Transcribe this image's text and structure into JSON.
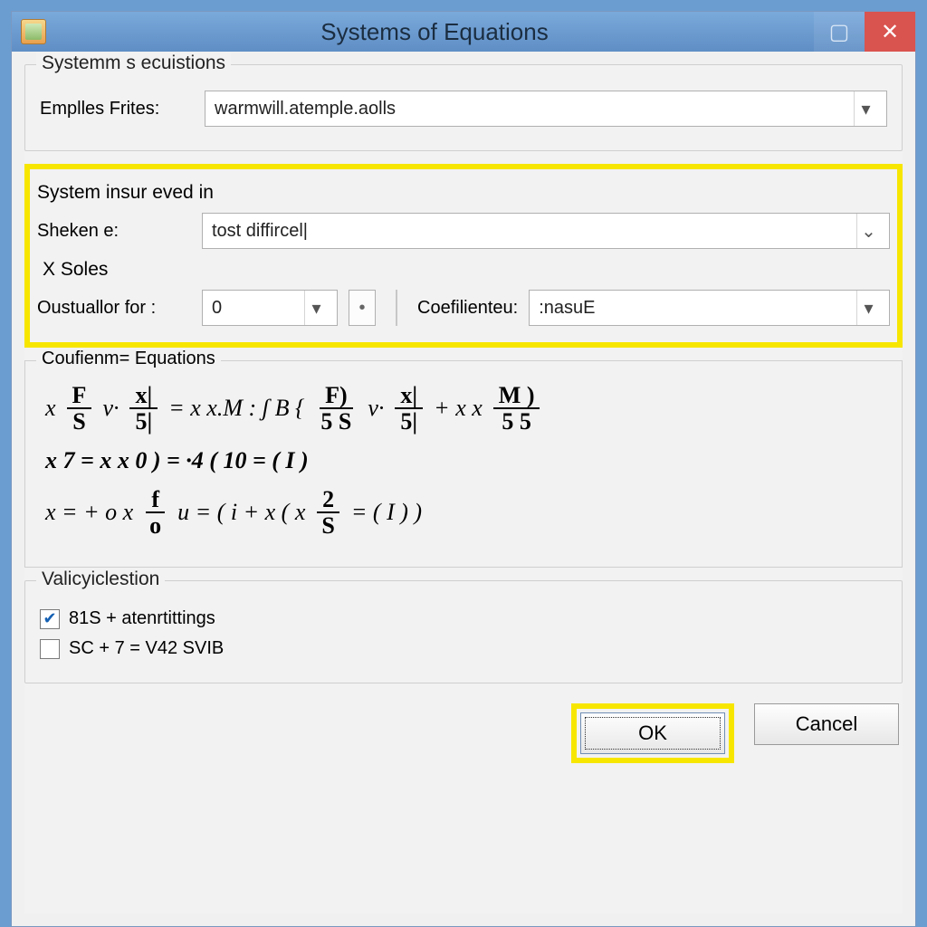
{
  "window": {
    "title": "Systems of Equations"
  },
  "group1": {
    "legend": "Systemm s ecuistions",
    "field_label": "Emplles Frites:",
    "field_value": "warmwill.atemple.aolls"
  },
  "highlight": {
    "heading": "System insur eved in",
    "sheken_label": "Sheken e:",
    "sheken_value": "tost diffircel|",
    "soles_heading": "X  Soles",
    "oust_label": "Oustuallor for :",
    "oust_value": "0",
    "coef_label": "Coefilienteu:",
    "coef_value": ":nasuE"
  },
  "equations": {
    "legend": "Coufienm= Equations",
    "eq1": {
      "a": "x",
      "f1n": "F",
      "f1d": "S",
      "b": "v·",
      "f2n": "x|",
      "f2d": "5|",
      "c": "= x x.M : ʃ B {",
      "f3n": "F)",
      "f3d": "5 S",
      "d": "v·",
      "f4n": "x|",
      "f4d": "5|",
      "e": "+ x x",
      "f5n": "M )",
      "f5d": "5 5"
    },
    "eq2": "x 7 = x x 0 ) = ·4 ( 10 = ( I )",
    "eq3": {
      "a": "x = + o x",
      "fn": "f",
      "fd": "o",
      "b": "u = ( i + x ( x",
      "gn": "2",
      "gd": "S",
      "c": "= ( I ) )"
    }
  },
  "validation": {
    "legend": "Valicyiclestion",
    "opt1": "81S + atenrtittings",
    "opt1_checked": true,
    "opt2": "SC + 7 = V42 SVIB",
    "opt2_checked": false
  },
  "buttons": {
    "ok": "OK",
    "cancel": "Cancel"
  }
}
